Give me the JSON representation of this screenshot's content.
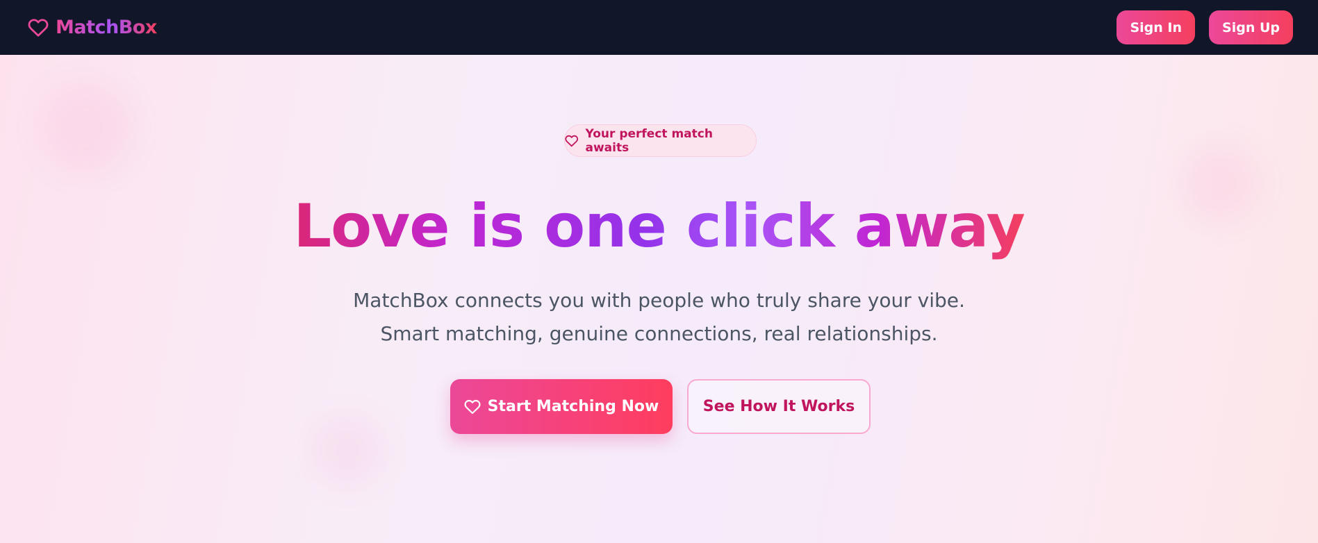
{
  "nav": {
    "brand": "MatchBox",
    "brand_icon": "heart-icon",
    "sign_in": "Sign In",
    "sign_up": "Sign Up"
  },
  "hero": {
    "badge_icon": "heart-icon",
    "badge": "Your perfect match awaits",
    "headline": "Love is one click away",
    "subtitle_line1": "MatchBox connects you with people who truly share your vibe.",
    "subtitle_line2": "Smart matching, genuine connections, real relationships.",
    "cta_primary": "Start Matching Now",
    "cta_primary_icon": "heart-icon",
    "cta_secondary": "See How It Works"
  },
  "colors": {
    "nav_background": "#111729",
    "accent_pink": "#ec4899",
    "accent_purple": "#9333ea",
    "accent_red": "#f43f5e",
    "badge_text": "#c0145c",
    "body_text": "#4b5563"
  }
}
